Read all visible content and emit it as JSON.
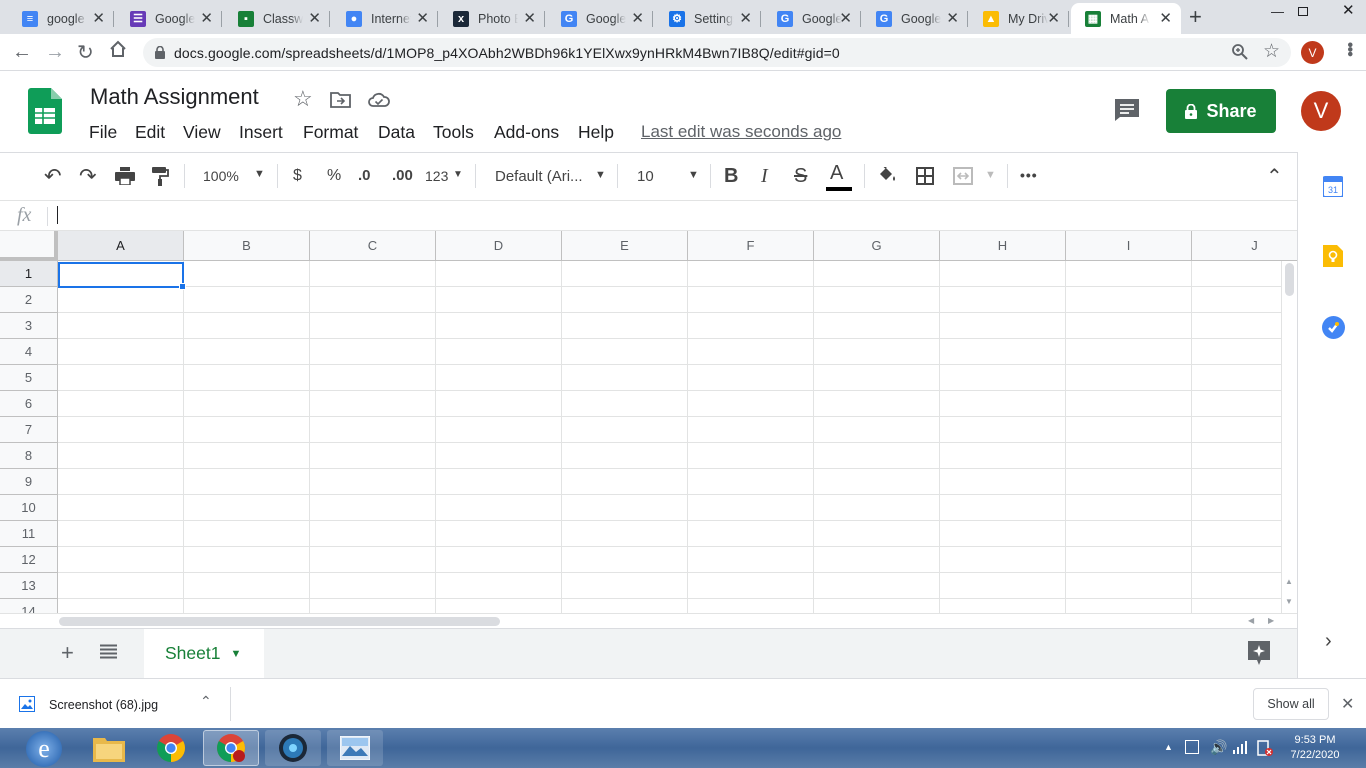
{
  "browser": {
    "tabs": [
      {
        "title": "google",
        "icon": "docs-icon",
        "color": "#4285f4",
        "glyph": "≡"
      },
      {
        "title": "Google",
        "icon": "forms-icon",
        "color": "#673ab7",
        "glyph": "☰"
      },
      {
        "title": "Classwo",
        "icon": "classroom-icon",
        "color": "#188038",
        "glyph": "▪"
      },
      {
        "title": "Internet",
        "icon": "account-icon",
        "color": "#4285f4",
        "glyph": "●"
      },
      {
        "title": "Photo E",
        "icon": "photo-editor-icon",
        "color": "#1b2838",
        "glyph": "x"
      },
      {
        "title": "Google",
        "icon": "google-icon",
        "color": "#4285f4",
        "glyph": "G"
      },
      {
        "title": "Settings",
        "icon": "settings-gear-icon",
        "color": "#1a73e8",
        "glyph": "⚙"
      },
      {
        "title": "Google",
        "icon": "google-icon",
        "color": "#4285f4",
        "glyph": "G"
      },
      {
        "title": "Google",
        "icon": "google-icon",
        "color": "#4285f4",
        "glyph": "G"
      },
      {
        "title": "My Driv",
        "icon": "drive-icon",
        "color": "#fbbc04",
        "glyph": "▲"
      },
      {
        "title": "Math A",
        "icon": "sheets-icon",
        "color": "#188038",
        "glyph": "▦"
      }
    ],
    "url": "docs.google.com/spreadsheets/d/1MOP8_p4XOAbh2WBDh96k1YElXwx9ynHRkM4Bwn7IB8Q/edit#gid=0",
    "profile_initial": "V"
  },
  "doc": {
    "title": "Math Assignment",
    "menus": [
      "File",
      "Edit",
      "View",
      "Insert",
      "Format",
      "Data",
      "Tools",
      "Add-ons",
      "Help"
    ],
    "last_edit": "Last edit was seconds ago",
    "share_label": "Share",
    "avatar_initial": "V"
  },
  "toolbar": {
    "zoom": "100%",
    "currency": "$",
    "percent": "%",
    "decrease_decimal": ".0",
    "increase_decimal": ".00",
    "more_formats": "123",
    "font": "Default (Ari...",
    "font_size": "10",
    "bold": "B",
    "italic": "I",
    "strike": "S",
    "text_color": "A",
    "more": "•••"
  },
  "formula": {
    "fx_label": "fx"
  },
  "grid": {
    "columns": [
      "A",
      "B",
      "C",
      "D",
      "E",
      "F",
      "G",
      "H",
      "I",
      "J"
    ],
    "rows": [
      "1",
      "2",
      "3",
      "4",
      "5",
      "6",
      "7",
      "8",
      "9",
      "10",
      "11",
      "12",
      "13",
      "14"
    ],
    "selected_cell": "A1"
  },
  "sheets": {
    "active": "Sheet1"
  },
  "download": {
    "filename": "Screenshot (68).jpg",
    "show_all": "Show all"
  },
  "taskbar": {
    "time": "9:53 PM",
    "date": "7/22/2020"
  }
}
